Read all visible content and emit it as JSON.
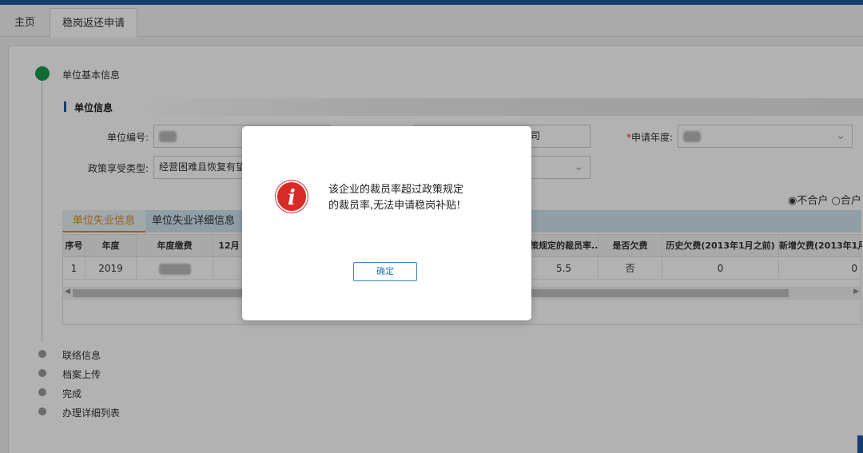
{
  "tabs": {
    "home": "主页",
    "active": "稳岗返还申请"
  },
  "steps": [
    {
      "label": "单位基本信息",
      "status": "active"
    },
    {
      "label": "联络信息",
      "status": "pending"
    },
    {
      "label": "档案上传",
      "status": "pending"
    },
    {
      "label": "完成",
      "status": "pending"
    },
    {
      "label": "办理详细列表",
      "status": "pending"
    }
  ],
  "section": {
    "title": "单位信息"
  },
  "form": {
    "unit_no_label": "单位编号:",
    "unit_name_partial": "司",
    "apply_year_required": "*",
    "apply_year_label": "申请年度:",
    "policy_type_label": "政策享受类型:",
    "policy_type_value": "经营困难且恢复有望?"
  },
  "compliance": {
    "option_not_compliant": "不合户",
    "option_compliant": "合户",
    "selected": "不合户"
  },
  "subtabs": {
    "tab1": "单位失业信息",
    "tab2": "单位失业详细信息"
  },
  "table": {
    "headers": [
      "序号",
      "年度",
      "年度缴费",
      "12月",
      "策规定的裁员率...",
      "是否欠费",
      "历史欠费(2013年1月之前)",
      "新增欠费(2013年1月之"
    ],
    "rows": [
      [
        "1",
        "2019",
        "",
        "",
        "5.5",
        "否",
        "0",
        "0"
      ]
    ]
  },
  "dialog": {
    "icon": "info-icon",
    "message_line1": "该企业的裁员率超过政策规定",
    "message_line2": "的裁员率,无法申请稳岗补贴!",
    "ok_label": "确定"
  },
  "colors": {
    "top_strip": "#1e5aa0",
    "active_step": "#1a9a4a",
    "alert_icon": "#d92a28",
    "subtab_active": "#d98a2a"
  }
}
